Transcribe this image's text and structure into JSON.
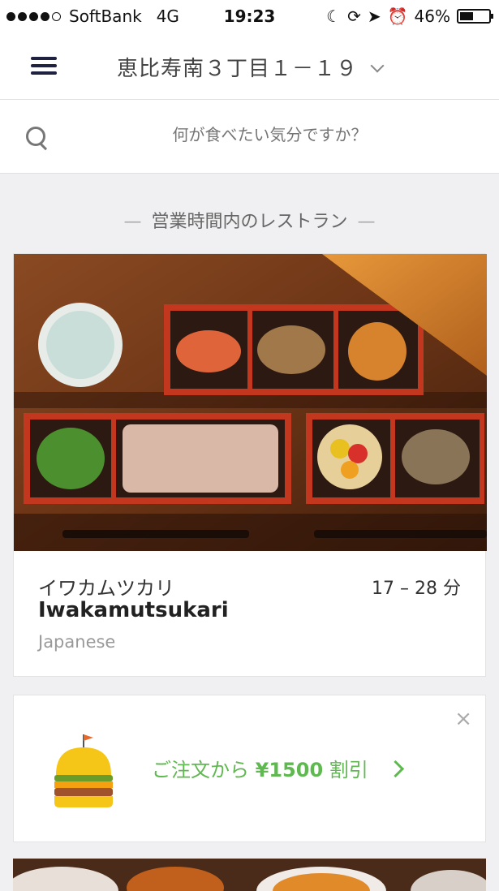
{
  "status_bar": {
    "carrier": "SoftBank",
    "network": "4G",
    "time": "19:23",
    "battery": "46%",
    "battery_level": 0.46,
    "icons": [
      "moon-icon",
      "rotation-lock-icon",
      "location-arrow-icon",
      "alarm-icon"
    ]
  },
  "header": {
    "address": "恵比寿南３丁目１－１９",
    "menu_icon": "hamburger-icon"
  },
  "search": {
    "placeholder": "何が食べたい気分ですか？",
    "icon": "search-icon"
  },
  "section": {
    "title": "営業時間内のレストラン"
  },
  "restaurant": {
    "name_jp": "イワカムツカリ",
    "name_en": "Iwakamutsukari",
    "cuisine": "Japanese",
    "delivery_time": "17 – 28 分"
  },
  "promo": {
    "prefix": "ご注文から",
    "amount": "¥1500",
    "suffix": "割引",
    "close_label": "×",
    "icon": "burger-icon",
    "accent_color": "#5fb850"
  },
  "colors": {
    "nav_icon": "#1e2140",
    "background": "#f0f0f2",
    "promo_green": "#5fb850"
  }
}
